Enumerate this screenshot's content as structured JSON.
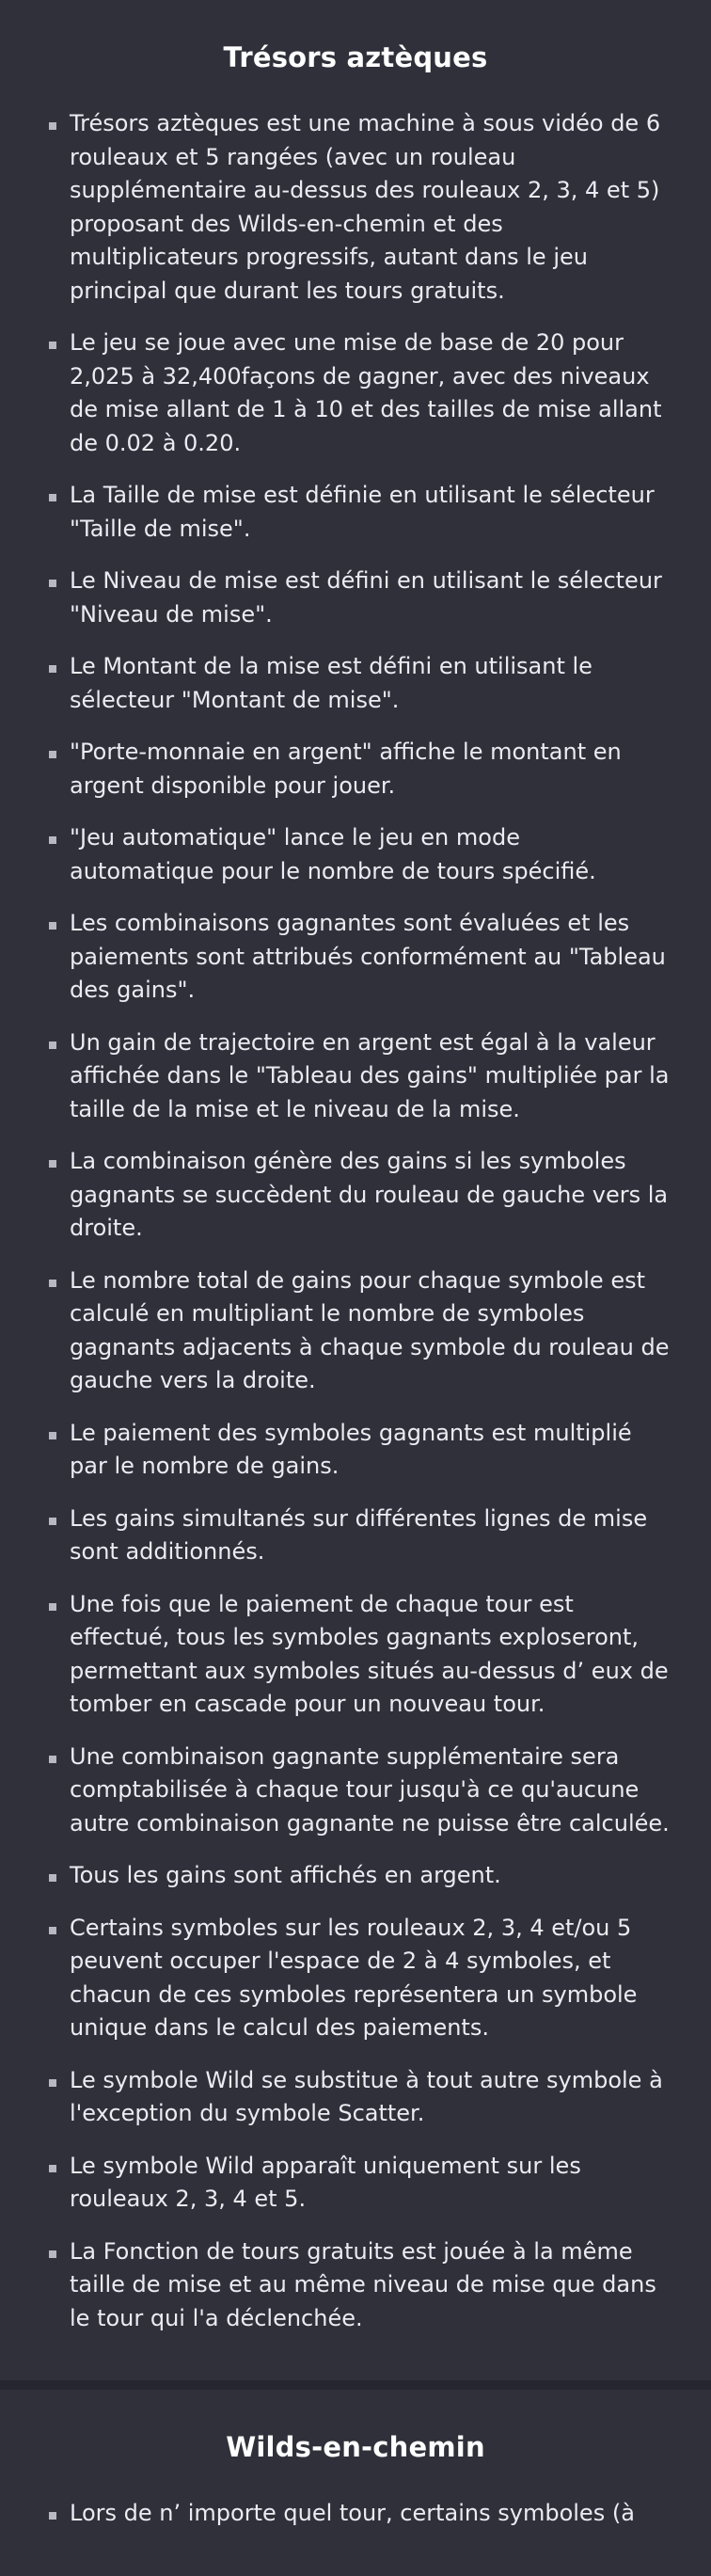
{
  "sections": [
    {
      "title": "Trésors aztèques",
      "items": [
        "Trésors aztèques est une machine à sous vidéo de 6 rouleaux et 5 rangées (avec un rouleau supplémentaire au-dessus des rouleaux 2, 3, 4 et 5) proposant des Wilds-en-chemin et des multiplicateurs progressifs, autant dans le jeu principal que durant les tours gratuits.",
        "Le jeu se joue avec une mise de base de 20 pour 2,025 à 32,400façons de gagner, avec des niveaux de mise allant de 1 à 10 et des tailles de mise allant de 0.02 à 0.20.",
        "La Taille de mise est définie en utilisant le sélecteur \"Taille de mise\".",
        "Le Niveau de mise est défini en utilisant le sélecteur \"Niveau de mise\".",
        "Le Montant de la mise est défini en utilisant le sélecteur \"Montant de mise\".",
        "\"Porte-monnaie en argent\" affiche le montant en argent disponible pour jouer.",
        "\"Jeu automatique\" lance le jeu en mode automatique pour le nombre de tours spécifié.",
        "Les combinaisons gagnantes sont évaluées et les paiements sont attribués conformément au \"Tableau des gains\".",
        "Un gain de trajectoire en argent est égal à la valeur affichée dans le \"Tableau des gains\" multipliée par la taille de la mise et le niveau de la mise.",
        "La combinaison génère des gains si les symboles gagnants se succèdent du rouleau de gauche vers la droite.",
        "Le nombre total de gains pour chaque symbole est calculé en multipliant le nombre de symboles gagnants adjacents à chaque symbole du rouleau de gauche vers la droite.",
        "Le paiement des symboles gagnants est multiplié par le nombre de gains.",
        "Les gains simultanés sur différentes lignes de mise sont additionnés.",
        "Une fois que le paiement de chaque tour est effectué, tous les symboles gagnants exploseront, permettant aux symboles situés au-dessus d’ eux de tomber en cascade pour un nouveau tour.",
        "Une combinaison gagnante supplémentaire sera comptabilisée à chaque tour jusqu'à ce qu'aucune autre combinaison gagnante ne puisse être calculée.",
        "Tous les gains sont affichés en argent.",
        "Certains symboles sur les rouleaux 2, 3, 4 et/ou 5 peuvent occuper l'espace de 2 à 4 symboles, et chacun de ces symboles représentera un symbole unique dans le calcul des paiements.",
        "Le symbole Wild se substitue à tout autre symbole à l'exception du symbole Scatter.",
        "Le symbole Wild apparaît uniquement sur les rouleaux 2, 3, 4 et 5.",
        "La Fonction de tours gratuits est jouée à la même taille de mise et au même niveau de mise que dans le tour qui l'a déclenchée."
      ]
    },
    {
      "title": "Wilds-en-chemin",
      "items": [
        "Lors de n’ importe quel tour, certains symboles (à"
      ]
    }
  ]
}
